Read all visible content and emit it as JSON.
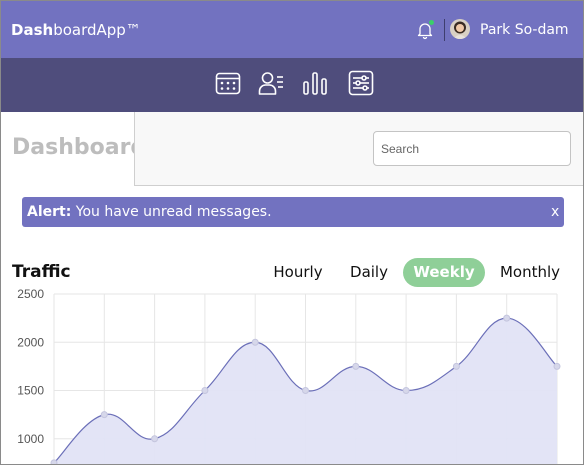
{
  "app": {
    "brand_bold": "Dash",
    "brand_rest": "boardApp™"
  },
  "header": {
    "user_name": "Park So-dam"
  },
  "toolbar": {
    "icons": [
      "calendar-icon",
      "contacts-icon",
      "bar-chart-icon",
      "settings-sliders-icon"
    ]
  },
  "page": {
    "title": "Dashboard"
  },
  "search": {
    "placeholder": "Search",
    "value": ""
  },
  "alert": {
    "label": "Alert:",
    "message": "You have unread messages.",
    "close": "x"
  },
  "traffic": {
    "title": "Traffic",
    "periods": [
      "Hourly",
      "Daily",
      "Weekly",
      "Monthly"
    ],
    "active_period": "Weekly"
  },
  "colors": {
    "brand": "#7272c0",
    "toolbar": "#4f4d7c",
    "active_tab": "#8fcf98",
    "area_fill": "#e2e3f5",
    "area_line": "#6b6fb8"
  },
  "chart_data": {
    "type": "area",
    "yticks": [
      2500,
      2000,
      1500,
      1000
    ],
    "ylim": [
      500,
      2500
    ],
    "x": [
      0,
      1,
      2,
      3,
      4,
      5,
      6,
      7,
      8,
      9,
      10
    ],
    "values": [
      750,
      1250,
      1000,
      1500,
      2000,
      1500,
      1750,
      1500,
      1750,
      2250,
      1750
    ],
    "grid": true
  }
}
